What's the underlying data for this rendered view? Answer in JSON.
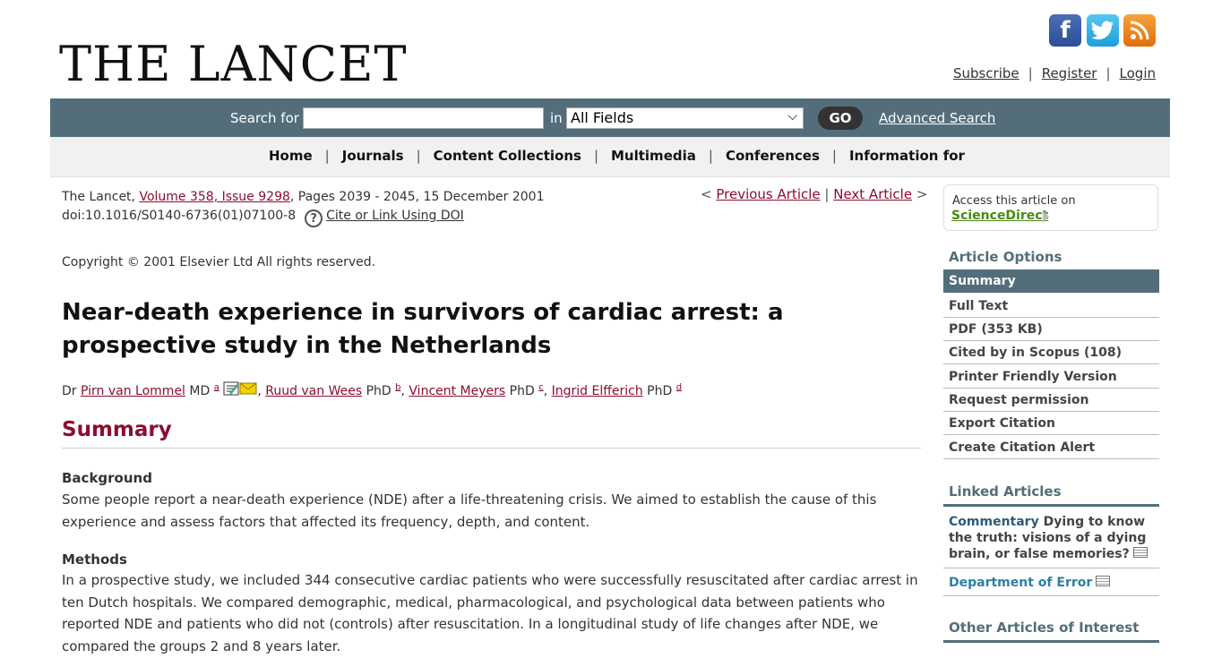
{
  "header": {
    "logo_text": "THE LANCET",
    "social": [
      "facebook-icon",
      "twitter-icon",
      "rss-icon"
    ],
    "links": [
      "Subscribe",
      "Register",
      "Login"
    ]
  },
  "search": {
    "label": "Search for",
    "input_value": "",
    "in_label": "in",
    "field_selected": "All Fields",
    "go_label": "GO",
    "advanced_label": "Advanced Search"
  },
  "nav": [
    "Home",
    "Journals",
    "Content Collections",
    "Multimedia",
    "Conferences",
    "Information for"
  ],
  "citation": {
    "journal": "The Lancet, ",
    "volume_link": "Volume 358, Issue 9298",
    "pages": ", Pages 2039 - 2045, 15 December 2001",
    "doi": "doi:10.1016/S0140-6736(01)07100-8",
    "doi_link": "Cite or Link Using DOI",
    "prev": "Previous Article",
    "next": "Next Article"
  },
  "copyright": "Copyright © 2001 Elsevier Ltd All rights reserved.",
  "article": {
    "title": "Near-death experience in survivors of cardiac arrest: a prospective study in the Netherlands",
    "authors": [
      {
        "prefix": "Dr ",
        "name": "Pirn van Lommel",
        "degree": " MD ",
        "sup": "a"
      },
      {
        "prefix": ", ",
        "name": "Ruud van Wees",
        "degree": " PhD ",
        "sup": "b"
      },
      {
        "prefix": ", ",
        "name": "Vincent Meyers",
        "degree": " PhD ",
        "sup": "c"
      },
      {
        "prefix": ", ",
        "name": "Ingrid Elfferich",
        "degree": " PhD ",
        "sup": "d"
      }
    ],
    "summary_heading": "Summary",
    "background_heading": "Background",
    "background_text": "Some people report a near-death experience (NDE) after a life-threatening crisis. We aimed to establish the cause of this experience and assess factors that affected its frequency, depth, and content.",
    "methods_heading": "Methods",
    "methods_text": "In a prospective study, we included 344 consecutive cardiac patients who were successfully resuscitated after cardiac arrest in ten Dutch hospitals. We compared demographic, medical, pharmacological, and psychological data between patients who reported NDE and patients who did not (controls) after resuscitation. In a longitudinal study of life changes after NDE, we compared the groups 2 and 8 years later."
  },
  "sidebar": {
    "access_text": "Access this article on",
    "access_link": "ScienceDirect",
    "options_heading": "Article Options",
    "options": [
      "Summary",
      "Full Text",
      "PDF (353 KB)",
      "Cited by in Scopus (108)",
      "Printer Friendly Version",
      "Request permission",
      "Export Citation",
      "Create Citation Alert"
    ],
    "linked_heading": "Linked Articles",
    "linked": [
      {
        "kind": "Commentary",
        "text": " Dying to know the truth: visions of a dying brain, or false memories?"
      },
      {
        "kind": "Department of Error",
        "text": ""
      }
    ],
    "other_heading": "Other Articles of Interest"
  },
  "colors": {
    "accent": "#536e7a",
    "link": "#8b0e2f",
    "sd_green": "#4a8a14"
  }
}
